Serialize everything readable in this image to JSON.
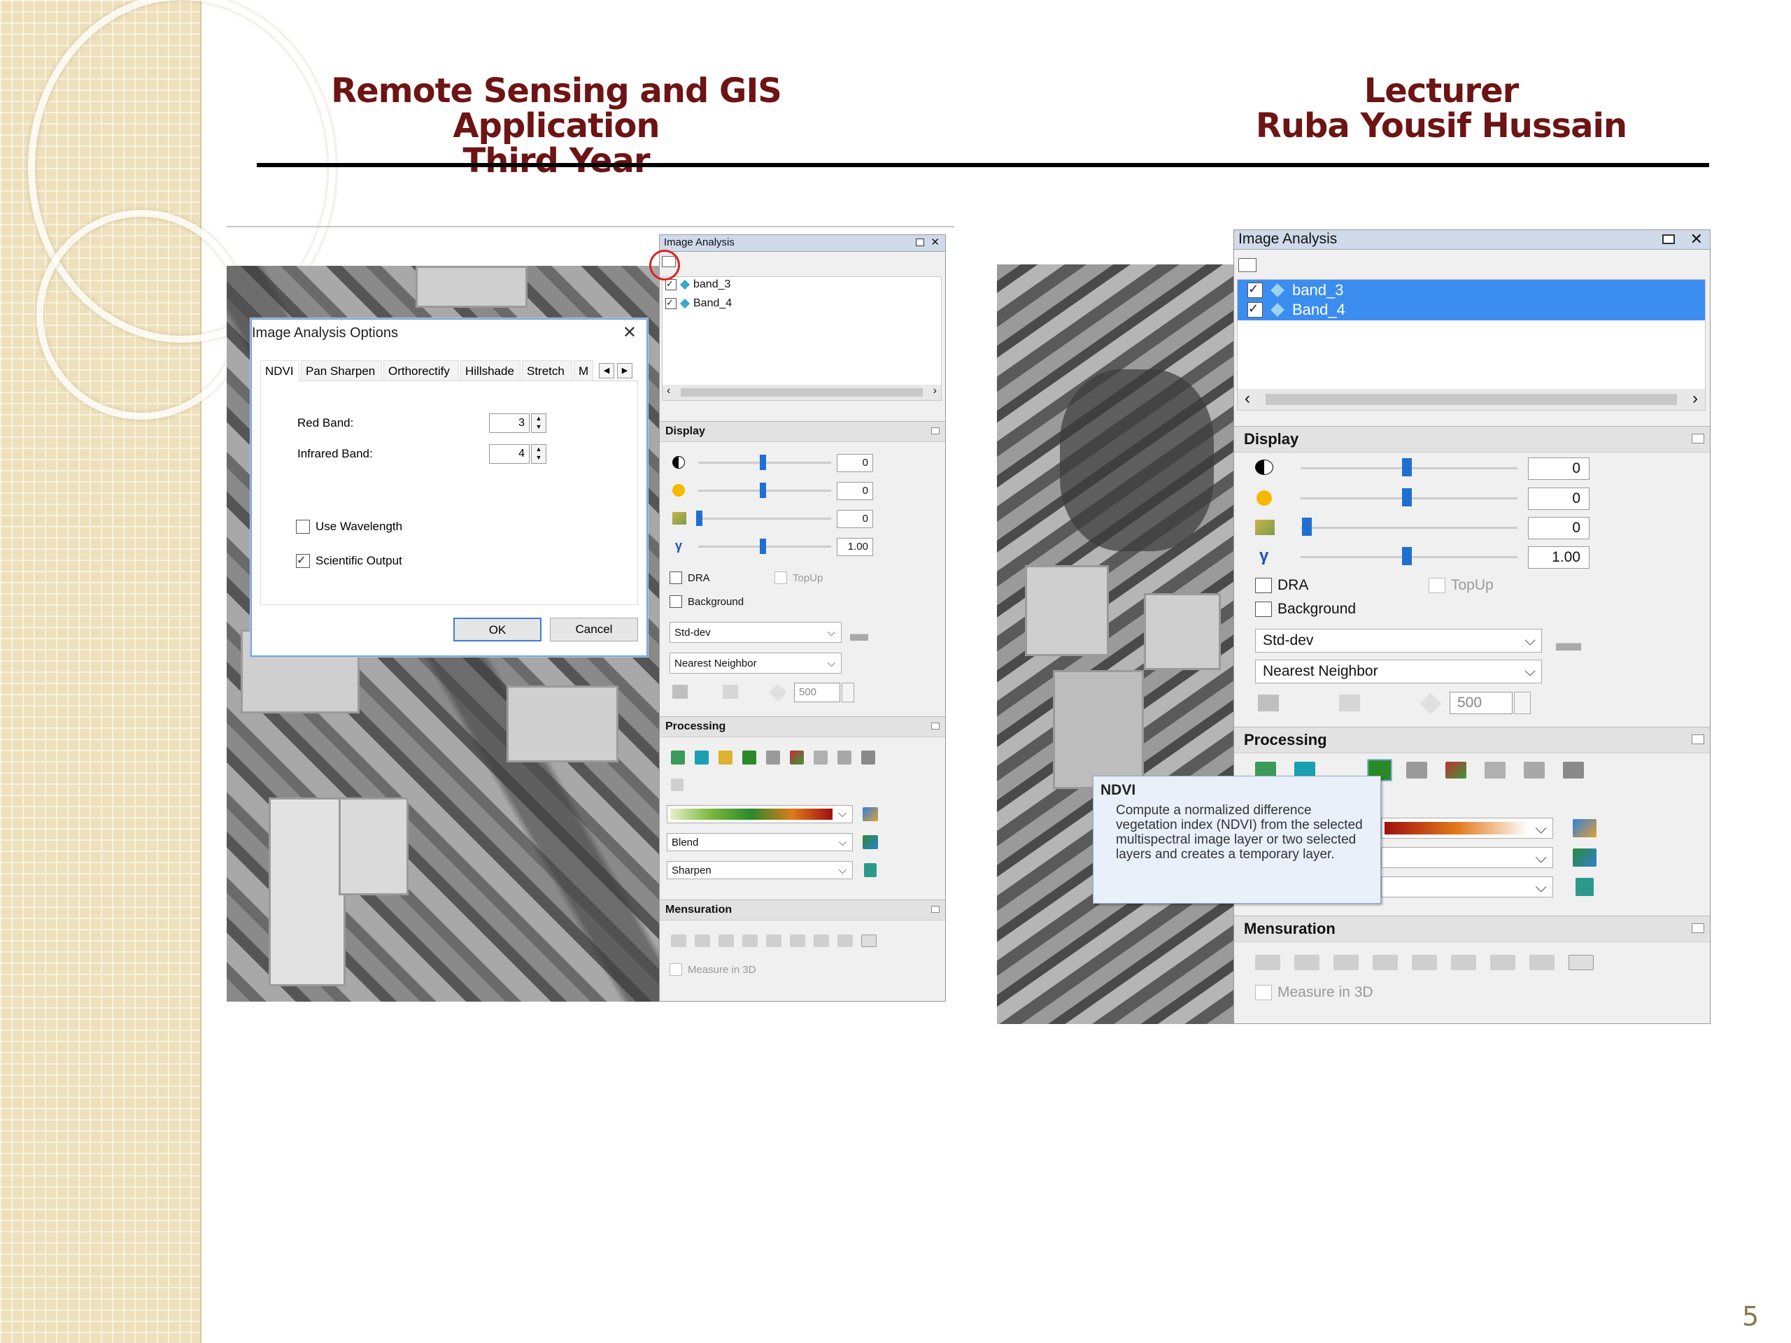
{
  "slide": {
    "title_line1": "Remote Sensing and GIS Application",
    "title_line2": "Third Year",
    "lecturer_label": "Lecturer",
    "lecturer_name": "Ruba Yousif Hussain",
    "page_number": "5"
  },
  "left_panel": {
    "title": "Image Analysis",
    "layers": [
      {
        "label": "band_3",
        "checked": true
      },
      {
        "label": "Band_4",
        "checked": true
      }
    ],
    "display": {
      "header": "Display",
      "contrast": "0",
      "brightness": "0",
      "transparency": "0",
      "gamma_symbol": "γ",
      "gamma": "1.00",
      "dra_label": "DRA",
      "topup_label": "TopUp",
      "background_label": "Background",
      "stretch": "Std-dev",
      "resampling": "Nearest Neighbor",
      "size_value": "500"
    },
    "processing": {
      "header": "Processing",
      "blend": "Blend",
      "sharpen": "Sharpen"
    },
    "mensuration": {
      "header": "Mensuration",
      "measure_3d": "Measure in 3D"
    }
  },
  "dialog": {
    "title": "Image Analysis Options",
    "close": "✕",
    "tabs": [
      "NDVI",
      "Pan Sharpen",
      "Orthorectify",
      "Hillshade",
      "Stretch",
      "M"
    ],
    "red_band_label": "Red Band:",
    "red_band_value": "3",
    "infrared_band_label": "Infrared Band:",
    "infrared_band_value": "4",
    "use_wavelength_label": "Use Wavelength",
    "use_wavelength_checked": false,
    "scientific_output_label": "Scientific Output",
    "scientific_output_checked": true,
    "ok": "OK",
    "cancel": "Cancel"
  },
  "right_panel": {
    "title": "Image Analysis",
    "layers": [
      {
        "label": "band_3",
        "checked": true,
        "selected": true
      },
      {
        "label": "Band_4",
        "checked": true,
        "selected": true
      }
    ],
    "display": {
      "header": "Display",
      "contrast": "0",
      "brightness": "0",
      "transparency": "0",
      "gamma_symbol": "γ",
      "gamma": "1.00",
      "dra_label": "DRA",
      "topup_label": "TopUp",
      "background_label": "Background",
      "stretch": "Std-dev",
      "resampling": "Nearest Neighbor",
      "size_value": "500"
    },
    "processing": {
      "header": "Processing"
    },
    "mensuration": {
      "header": "Mensuration",
      "measure_3d": "Measure in 3D"
    }
  },
  "tooltip": {
    "title": "NDVI",
    "body": "Compute a normalized difference vegetation index (NDVI) from the selected multispectral image layer or two selected layers and creates a temporary layer."
  },
  "colors": {
    "title_color": "#6d1414",
    "selection_blue": "#3c8df0",
    "slider_thumb": "#1f6fd1"
  }
}
